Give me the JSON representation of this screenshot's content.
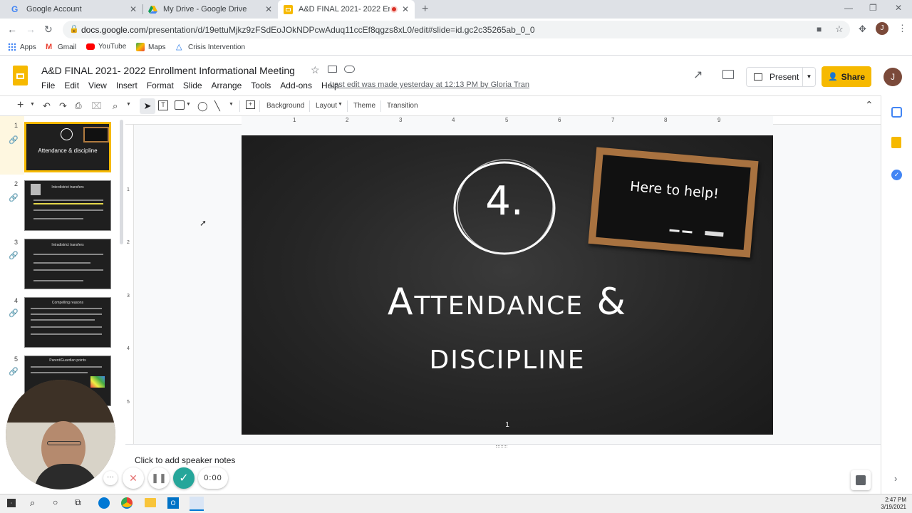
{
  "browser": {
    "tabs": [
      {
        "title": "Google Account",
        "active": false
      },
      {
        "title": "My Drive - Google Drive",
        "active": false
      },
      {
        "title": "A&D FINAL 2021- 2022 Enro",
        "active": true
      }
    ],
    "url_domain": "docs.google.com",
    "url_path": "/presentation/d/19ettuMjkz9zFSdEoJOkNDPcwAduq11ccEf8qgzs8xL0/edit#slide=id.gc2c35265ab_0_0",
    "bookmarks": [
      "Apps",
      "Gmail",
      "YouTube",
      "Maps",
      "Crisis Intervention"
    ],
    "profile_initial": "J"
  },
  "doc": {
    "title": "A&D FINAL 2021- 2022 Enrollment Informational Meeting",
    "menu": [
      "File",
      "Edit",
      "View",
      "Insert",
      "Format",
      "Slide",
      "Arrange",
      "Tools",
      "Add-ons",
      "Help"
    ],
    "last_edit": "Last edit was made yesterday at 12:13 PM by Gloria Tran",
    "present_label": "Present",
    "share_label": "Share",
    "avatar_initial": "J"
  },
  "toolbar": {
    "background": "Background",
    "layout": "Layout",
    "theme": "Theme",
    "transition": "Transition"
  },
  "ruler": [
    "1",
    "2",
    "3",
    "4",
    "5",
    "6",
    "7",
    "8",
    "9"
  ],
  "vruler": [
    "1",
    "2",
    "3",
    "4",
    "5"
  ],
  "slides": [
    {
      "num": "1",
      "title": "Attendance & discipline"
    },
    {
      "num": "2",
      "title": "Interdistrict transfers"
    },
    {
      "num": "3",
      "title": "Intradistrict transfers"
    },
    {
      "num": "4",
      "title": "Compelling reasons"
    },
    {
      "num": "5",
      "title": "Parent/Guardian points"
    }
  ],
  "current_slide": {
    "circle_number": "4.",
    "chalkboard_text": "Here to help!",
    "title_line1": "Attendance &",
    "title_line2": "discipline",
    "page_number": "1"
  },
  "notes_placeholder": "Click to add speaker notes",
  "recorder": {
    "timer": "0:00"
  },
  "taskbar": {
    "time": "2:47 PM",
    "date": "3/19/2021"
  }
}
